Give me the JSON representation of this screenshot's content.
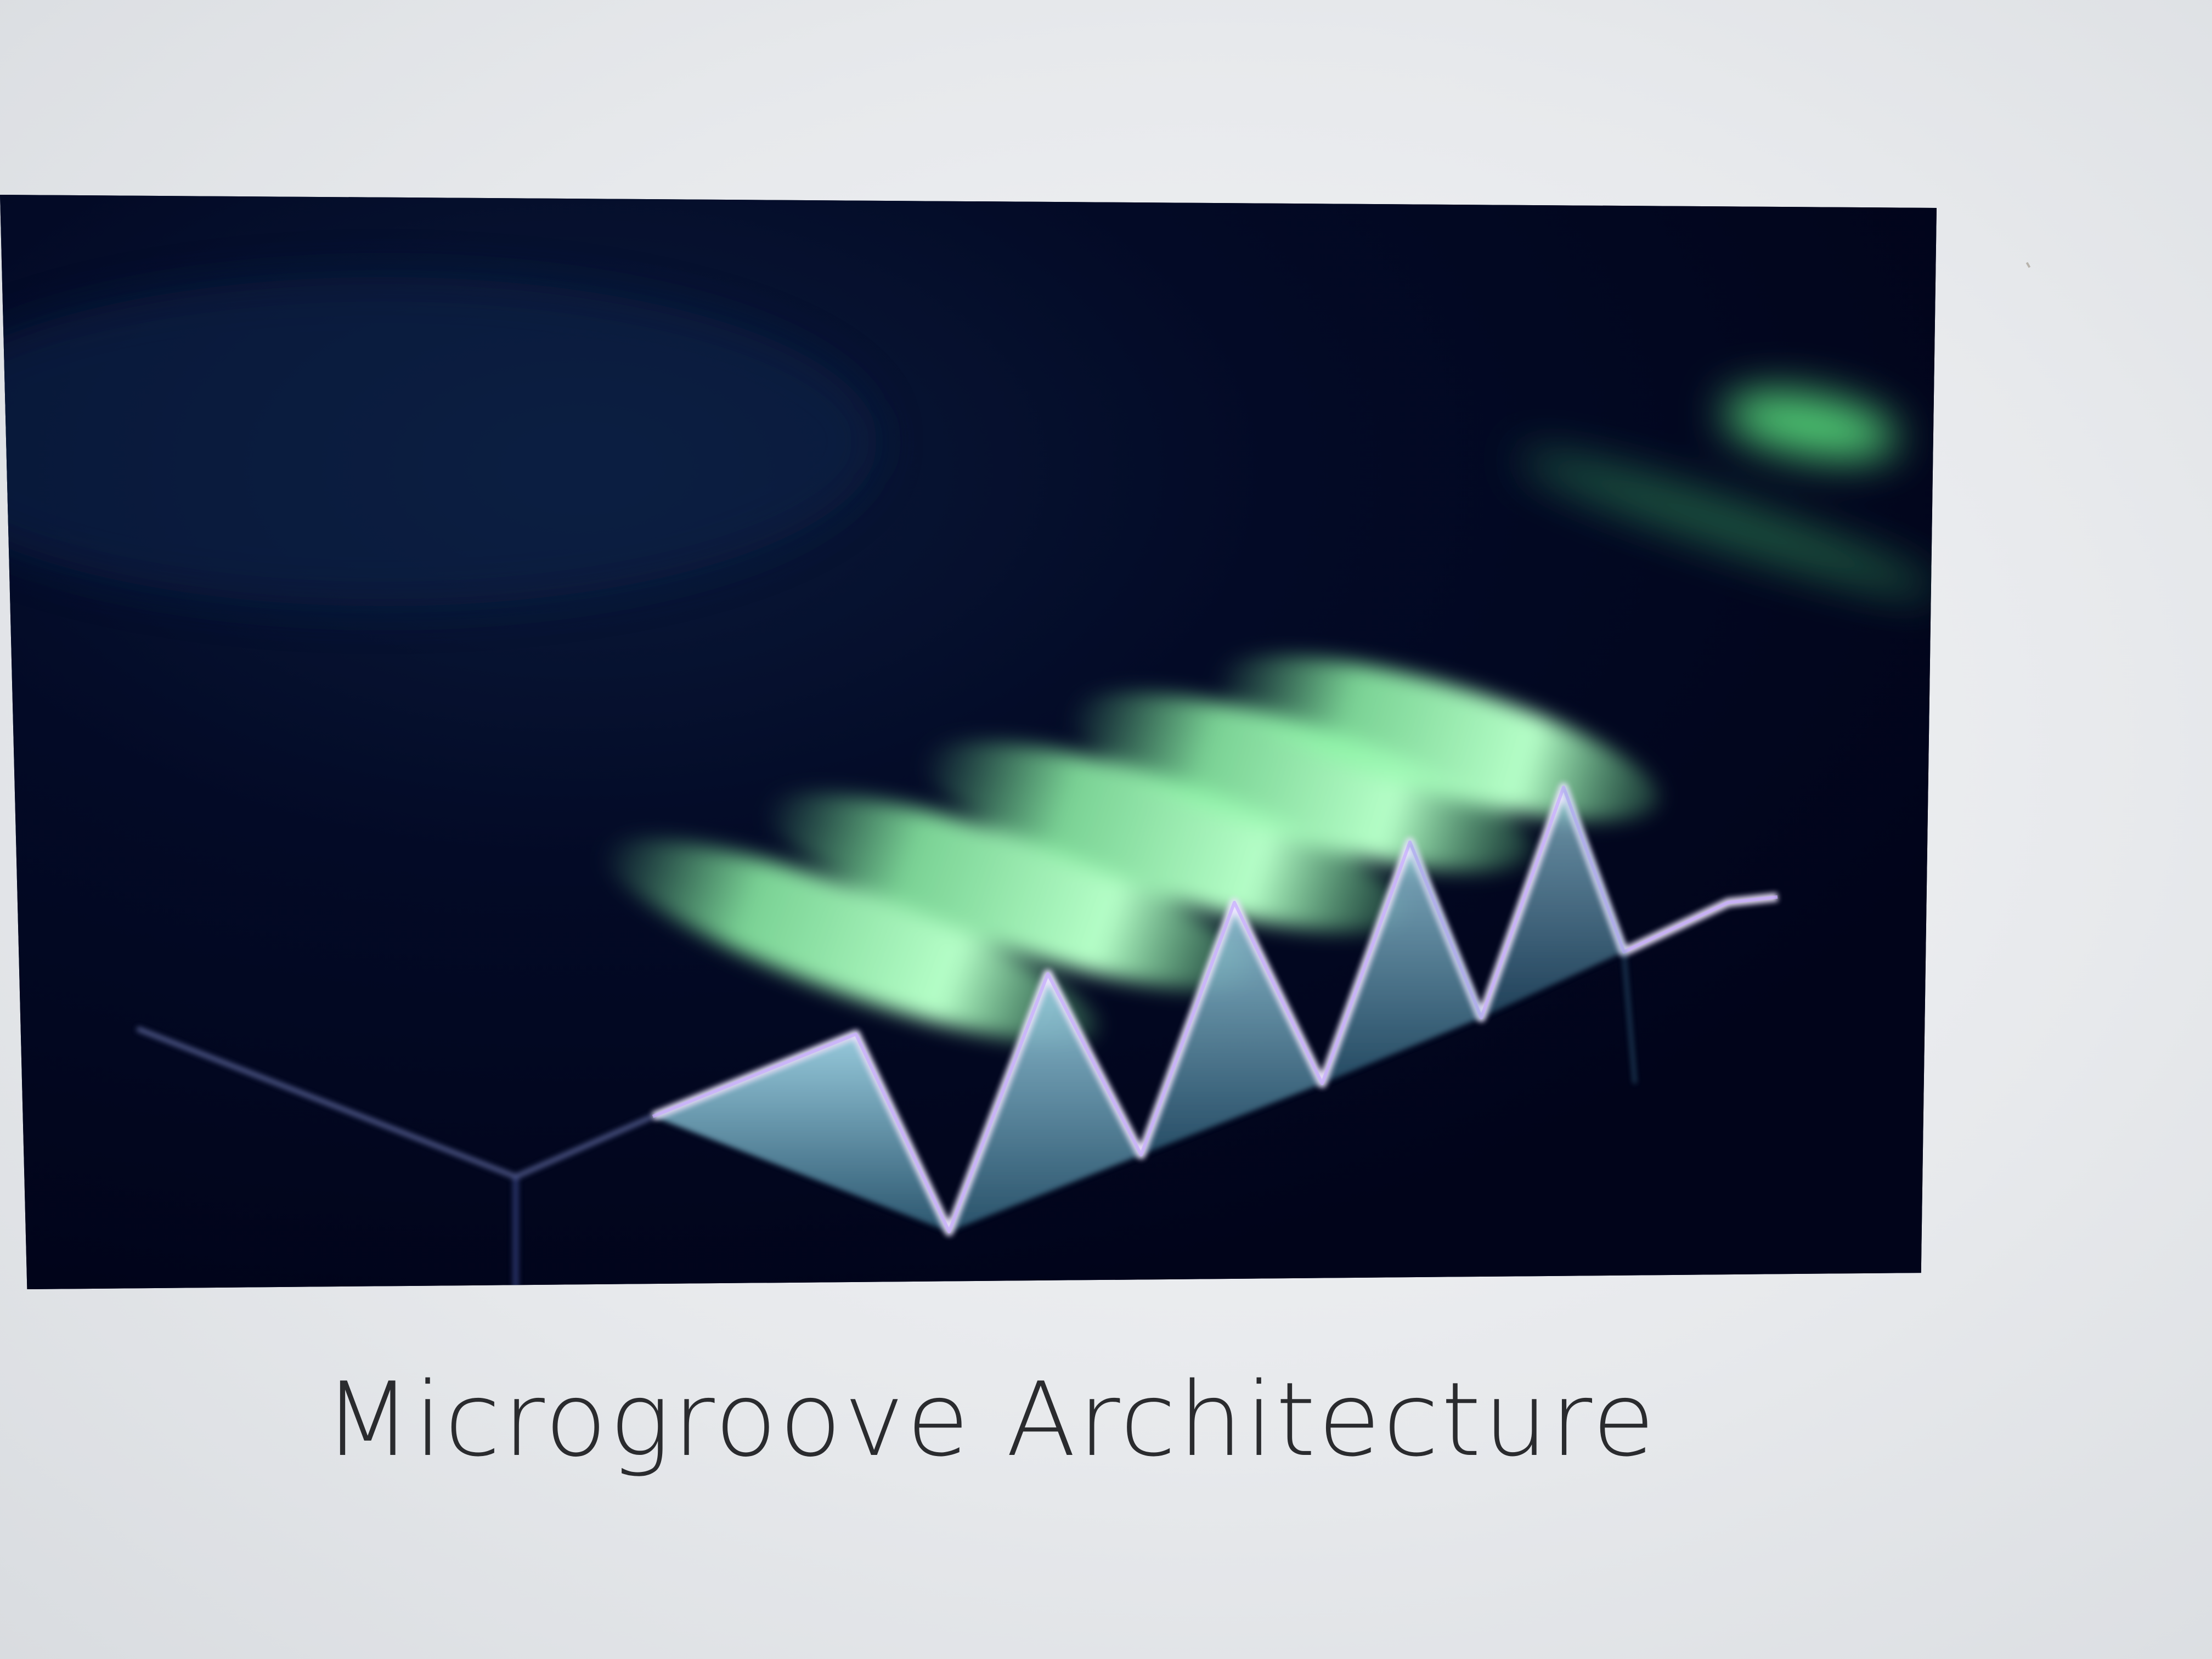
{
  "caption": {
    "text": "Microgroove Architecture"
  },
  "image": {
    "description_icon": "microgroove-render-image",
    "colors": {
      "background": "#02061d",
      "glow": "#7cf29a",
      "glow_core": "#b6ffc8",
      "groove_face": "#4f8fa8",
      "groove_edge": "#e7e0f5"
    }
  }
}
